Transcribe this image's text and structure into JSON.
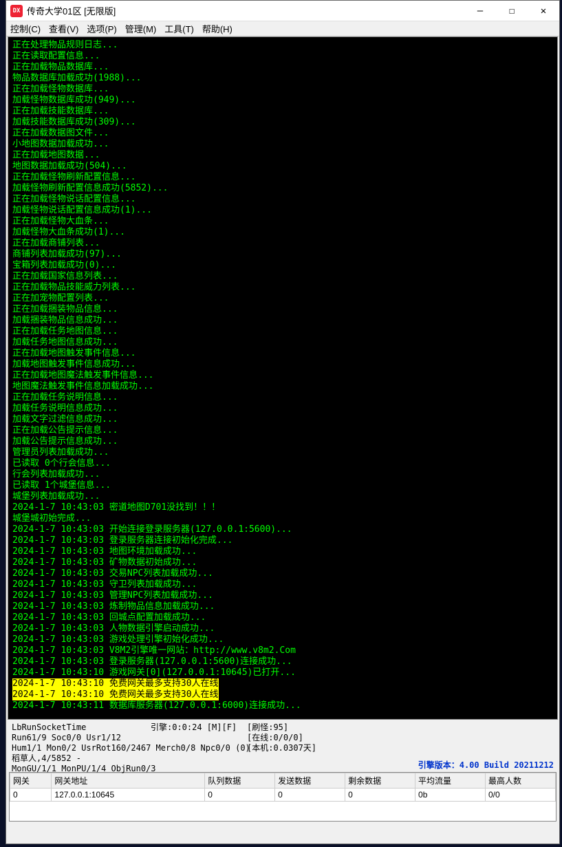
{
  "window": {
    "title": "传奇大学01区 [无限版]",
    "icon_label": "DX"
  },
  "menu": {
    "control": "控制(C)",
    "view": "查看(V)",
    "options": "选项(P)",
    "manage": "管理(M)",
    "tools": "工具(T)",
    "help": "帮助(H)"
  },
  "log_lines": [
    "正在处理物品规则日志...",
    "正在读取配置信息...",
    "正在加载物品数据库...",
    "物品数据库加载成功(1988)...",
    "正在加载怪物数据库...",
    "加载怪物数据库成功(949)...",
    "正在加载技能数据库...",
    "加载技能数据库成功(309)...",
    "正在加载数据图文件...",
    "小地图数据加载成功...",
    "正在加载地图数据...",
    "地图数据加载成功(504)...",
    "正在加载怪物刷新配置信息...",
    "加载怪物刷新配置信息成功(5852)...",
    "正在加载怪物说话配置信息...",
    "加载怪物说话配置信息成功(1)...",
    "正在加载怪物大血条...",
    "加载怪物大血条成功(1)...",
    "正在加载商铺列表...",
    "商铺列表加载成功(97)...",
    "宝箱列表加载成功(0)...",
    "正在加载国家信息列表...",
    "正在加载物品技能威力列表...",
    "正在加宠物配置列表...",
    "正在加载捆装物品信息...",
    "加载捆装物品信息成功...",
    "正在加载任务地图信息...",
    "加载任务地图信息成功...",
    "正在加载地图触发事件信息...",
    "加载地图触发事件信息成功...",
    "正在加载地图魔法触发事件信息...",
    "地图魔法触发事件信息加载成功...",
    "正在加载任务说明信息...",
    "加载任务说明信息成功...",
    "加载文字过滤信息成功...",
    "正在加载公告提示信息...",
    "加载公告提示信息成功...",
    "管理员列表加载成功...",
    "已读取 0个行会信息...",
    "行会列表加载成功...",
    "已读取 1个城堡信息...",
    "城堡列表加载成功...",
    "2024-1-7 10:43:03 密道地图D701没找到！！！",
    "城堡城初始完成...",
    "2024-1-7 10:43:03 开始连接登录服务器(127.0.0.1:5600)...",
    "2024-1-7 10:43:03 登录服务器连接初始化完成...",
    "2024-1-7 10:43:03 地图环境加载成功...",
    "2024-1-7 10:43:03 矿物数据初始成功...",
    "2024-1-7 10:43:03 交易NPC列表加载成功...",
    "2024-1-7 10:43:03 守卫列表加载成功...",
    "2024-1-7 10:43:03 管理NPC列表加载成功...",
    "2024-1-7 10:43:03 炼制物品信息加载成功...",
    "2024-1-7 10:43:03 回城点配置加载成功...",
    "2024-1-7 10:43:03 人物数据引擎启动成功...",
    "2024-1-7 10:43:03 游戏处理引擎初始化成功...",
    "2024-1-7 10:43:03 V8M2引擎唯一网站：http://www.v8m2.Com",
    "2024-1-7 10:43:03 登录服务器(127.0.0.1:5600)连接成功...",
    "2024-1-7 10:43:10 游戏网关[0](127.0.0.1:10645)已打开..."
  ],
  "log_hl": [
    "2024-1-7 10:43:10 免费网关最多支持30人在线",
    "2024-1-7 10:43:10 免费网关最多支持30人在线"
  ],
  "log_after": [
    "2024-1-7 10:43:11 数据库服务器(127.0.0.1:6000)连接成功..."
  ],
  "status": {
    "c1": [
      "LbRunSocketTime",
      "Run61/9 Soc0/0 Usr1/12",
      "Hum1/1 Mon0/2 UsrRot160/2467 Merch0/8 Npc0/0 (0)",
      "稻草人,4/5852 -",
      "MonGU/1/1 MonPU/1/4 ObjRun0/3"
    ],
    "c2": "引擎:0:0:24 [M][F]",
    "c3": [
      "[刷怪:95]",
      "[在线:0/0/0]",
      "[本机:0.0307天]"
    ],
    "version": "引擎版本：4.00 Build 20211212"
  },
  "table": {
    "headers": [
      "网关",
      "网关地址",
      "队列数据",
      "发送数据",
      "剩余数据",
      "平均流量",
      "最高人数"
    ],
    "row": [
      "0",
      "127.0.0.1:10645",
      "0",
      "0",
      "0",
      "0b",
      "0/0"
    ]
  }
}
